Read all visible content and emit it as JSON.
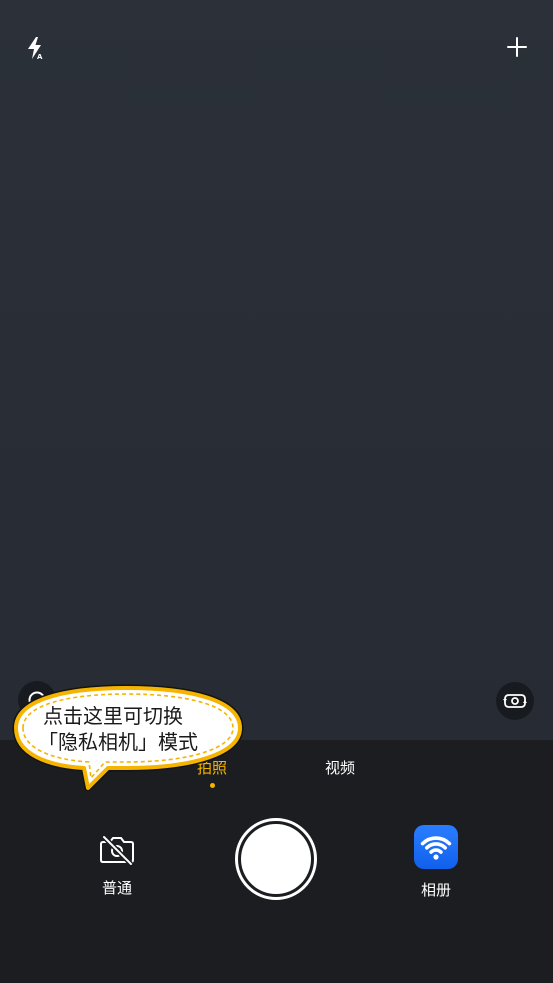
{
  "colors": {
    "viewfinder": "#2b3039",
    "bottom_bar": "#1c1d21",
    "accent": "#f5b400",
    "text": "#ffffff",
    "album_icon": "#1160ec"
  },
  "top_bar": {
    "flash": {
      "icon": "flash-auto-icon",
      "mode_badge": "A"
    },
    "add": {
      "icon": "plus-icon"
    }
  },
  "viewfinder": {
    "left_button": {
      "icon": "lens-icon"
    },
    "right_button": {
      "icon": "switch-camera-icon"
    }
  },
  "tooltip": {
    "lines": [
      "点击这里可切换",
      "「隐私相机」模式"
    ]
  },
  "modes": {
    "tabs": [
      {
        "label": "拍照",
        "active": true
      },
      {
        "label": "视频",
        "active": false
      }
    ]
  },
  "controls": {
    "privacy_toggle": {
      "icon": "camera-off-icon",
      "label": "普通"
    },
    "album": {
      "icon": "wifi-icon",
      "label": "相册"
    }
  }
}
